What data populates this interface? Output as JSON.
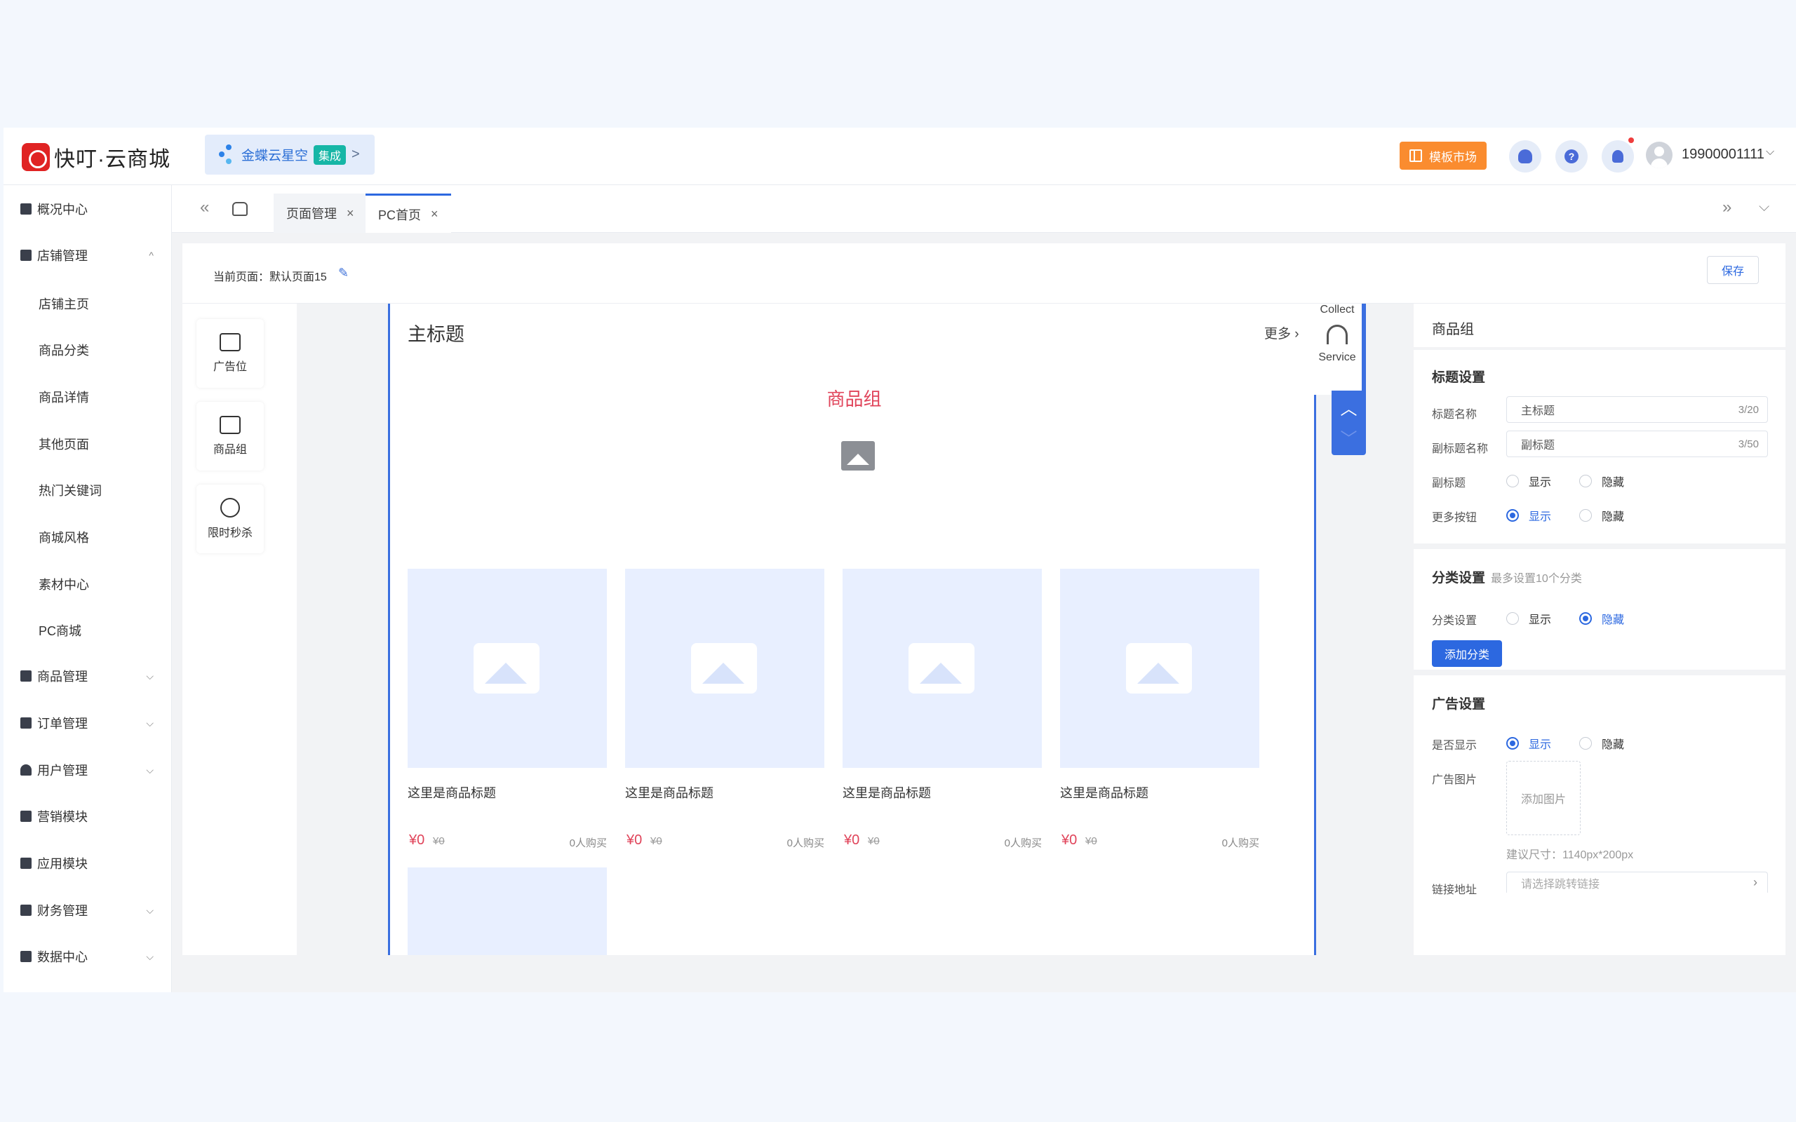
{
  "app": {
    "logo_text": "快叮·云商城",
    "chip": {
      "label": "金蝶云星空",
      "badge": "集成",
      "arrow": ">"
    },
    "template_btn": "模板市场",
    "help_glyph": "?",
    "user_name": "19900001111",
    "user_caret": "⌵"
  },
  "sidebar": {
    "items": [
      {
        "label": "概况中心"
      },
      {
        "label": "店铺管理",
        "caret": "^"
      },
      {
        "label": "商品管理",
        "caret": "⌵"
      },
      {
        "label": "订单管理",
        "caret": "⌵"
      },
      {
        "label": "用户管理",
        "caret": "⌵"
      },
      {
        "label": "营销模块"
      },
      {
        "label": "应用模块"
      },
      {
        "label": "财务管理",
        "caret": "⌵"
      },
      {
        "label": "数据中心",
        "caret": "⌵"
      }
    ],
    "sub_items": [
      "店铺主页",
      "商品分类",
      "商品详情",
      "其他页面",
      "热门关键词",
      "商城风格",
      "素材中心",
      "PC商城"
    ]
  },
  "tabs": {
    "left_arrows": "«",
    "right_arrows": "»",
    "more": "⌵",
    "items": [
      {
        "label": "页面管理",
        "close": "×"
      },
      {
        "label": "PC首页",
        "close": "×"
      }
    ]
  },
  "editor": {
    "current_page": "当前页面：默认页面15",
    "edit_glyph": "✎",
    "save": "保存",
    "widgets": [
      "广告位",
      "商品组",
      "限时秒杀"
    ],
    "canvas": {
      "main_title": "主标题",
      "more": "更多 ›",
      "group_title": "商品组",
      "products": [
        {
          "name": "这里是商品标题",
          "price": "¥0",
          "old_price": "¥0",
          "sold": "0人购买"
        },
        {
          "name": "这里是商品标题",
          "price": "¥0",
          "old_price": "¥0",
          "sold": "0人购买"
        },
        {
          "name": "这里是商品标题",
          "price": "¥0",
          "old_price": "¥0",
          "sold": "0人购买"
        },
        {
          "name": "这里是商品标题",
          "price": "¥0",
          "old_price": "¥0",
          "sold": "0人购买"
        }
      ],
      "float": {
        "collect": "Collect",
        "service": "Service",
        "up": "︿",
        "down": "﹀"
      }
    },
    "panel": {
      "title": "商品组",
      "title_settings": {
        "heading": "标题设置",
        "name_label": "标题名称",
        "name_value": "主标题",
        "name_count": "3/20",
        "sub_label": "副标题名称",
        "sub_value": "副标题",
        "sub_count": "3/50",
        "subtitle_label": "副标题",
        "more_label": "更多按钮",
        "show": "显示",
        "hide": "隐藏"
      },
      "category": {
        "heading": "分类设置",
        "hint": "最多设置10个分类",
        "label": "分类设置",
        "add": "添加分类"
      },
      "ad": {
        "heading": "广告设置",
        "show_label": "是否显示",
        "image_label": "广告图片",
        "upload": "添加图片",
        "size_hint": "建议尺寸：1140px*200px",
        "link_label": "链接地址",
        "link_placeholder": "请选择跳转链接",
        "link_arrow": "›"
      }
    }
  },
  "colors": {
    "accent": "#2c68e0",
    "brand": "#e02323",
    "price": "#e0445a",
    "orange": "#fa8c2f"
  }
}
